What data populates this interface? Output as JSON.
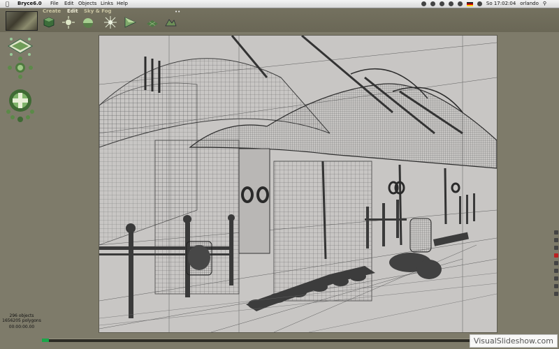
{
  "menubar": {
    "app_name": "Bryce6.0",
    "items": [
      "File",
      "Edit",
      "Objects",
      "Links",
      "Help"
    ],
    "clock": "So 17:02:04",
    "user": "orlando"
  },
  "toolbar": {
    "tabs": [
      "Create",
      "Edit",
      "Sky & Fog"
    ],
    "tools": [
      "cube-primitive-tool",
      "sun-tool",
      "sphere-cap-tool",
      "light-tool",
      "cone-tool",
      "grid-tool",
      "terrain-tool"
    ]
  },
  "status": {
    "objects": "296 objects",
    "polygons": "1656205 polygons",
    "time": "00:00:00.00"
  },
  "watermark": "VisualSlideshow.com",
  "colors": {
    "background": "#7e7b6a",
    "viewport": "#c8c6c4",
    "wire": "#3a3a3a",
    "solid": "#383838"
  }
}
